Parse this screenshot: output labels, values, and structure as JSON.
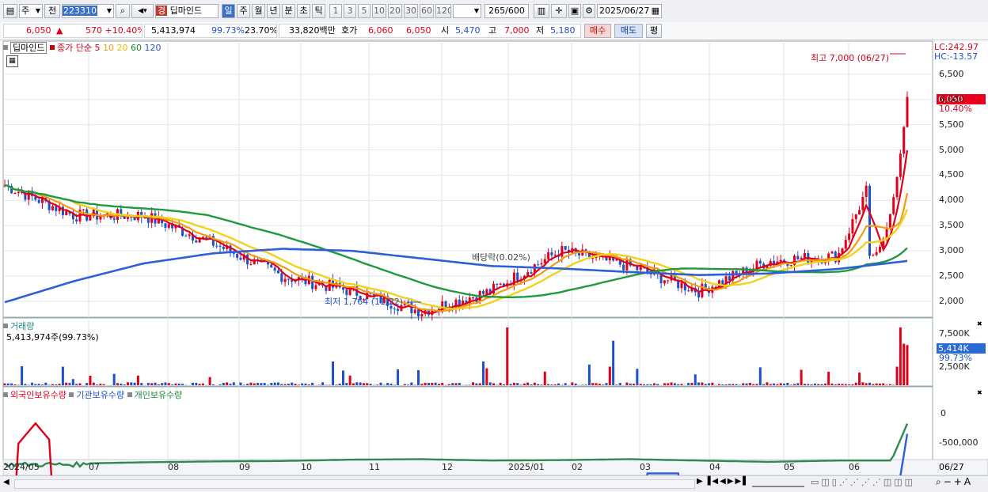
{
  "toolbar": {
    "stock_type": "주",
    "prev_label": "전",
    "code": "223310",
    "stock_name": "딥마인드",
    "badge": "경",
    "periods": [
      "일",
      "주",
      "월",
      "년",
      "분",
      "초",
      "틱"
    ],
    "active_period": "일",
    "numbers": [
      "1",
      "3",
      "5",
      "10",
      "20",
      "30",
      "60",
      "120"
    ],
    "count": "265",
    "count_total": "/600",
    "date": "2025/06/27"
  },
  "quote": {
    "price": "6,050",
    "change": "570 +10.40%",
    "volume": "5,413,974",
    "vol_ratio": "99.73%",
    "turnover": "23.70%",
    "amount": "33,820백만",
    "hoga_label": "호가",
    "ask": "6,060",
    "bid": "6,050",
    "open_label": "시",
    "open": "5,470",
    "high_label": "고",
    "high": "7,000",
    "low_label": "저",
    "low": "5,180",
    "buy_button": "매수",
    "sell_button": "매도",
    "eval_button": "평"
  },
  "price_panel": {
    "name": "딥마인드",
    "legend_label": "종가 단순",
    "ma_labels": [
      "5",
      "10",
      "20",
      "60",
      "120"
    ],
    "lc": "LC:242.97",
    "hc": "HC:-13.57",
    "high_note": "최고 7,000 (06/27)",
    "low_note": "최저 1,764 (11/22)",
    "event_note": "배당락(0.02%)",
    "current_price": "6,050",
    "current_change": "10.40%",
    "y_ticks": [
      "6,500",
      "6,000",
      "5,500",
      "5,000",
      "4,500",
      "4,000",
      "3,500",
      "3,000",
      "2,500",
      "2,000"
    ]
  },
  "volume_panel": {
    "title": "거래량",
    "value": "5,413,974주(99.73%)",
    "current": "5,414K",
    "current_ratio": "99.73%",
    "y_ticks": [
      "7,500K",
      "5,000K",
      "2,500K"
    ]
  },
  "holding_panel": {
    "foreign": "외국인보유수량",
    "institution": "기관보유수량",
    "individual": "개인보유수량",
    "y_ticks": [
      "0",
      "-500,000"
    ]
  },
  "x_axis": {
    "labels": [
      "2024/05",
      "07",
      "08",
      "09",
      "10",
      "11",
      "12",
      "2025/01",
      "02",
      "03",
      "04",
      "05",
      "06"
    ],
    "end_date": "06/27"
  },
  "chart_data": {
    "type": "line",
    "title": "딥마인드",
    "xlabel": "",
    "ylabel": "",
    "ylim": [
      1700,
      7000
    ],
    "x": [
      "2024/05",
      "07",
      "08",
      "09",
      "10",
      "11",
      "12",
      "2025/01",
      "02",
      "03",
      "04",
      "05",
      "06",
      "06/27"
    ],
    "series": [
      {
        "name": "종가",
        "values": [
          4300,
          3700,
          3700,
          3150,
          2500,
          2200,
          1800,
          2200,
          3000,
          2700,
          2200,
          2800,
          2900,
          6050
        ]
      },
      {
        "name": "120",
        "values": [
          1980,
          2400,
          2750,
          2950,
          3040,
          3000,
          2850,
          2700,
          2650,
          2580,
          2520,
          2550,
          2640,
          2800
        ]
      }
    ],
    "volume_ylim": [
      0,
      8000
    ],
    "volume_current_k": 5414
  }
}
